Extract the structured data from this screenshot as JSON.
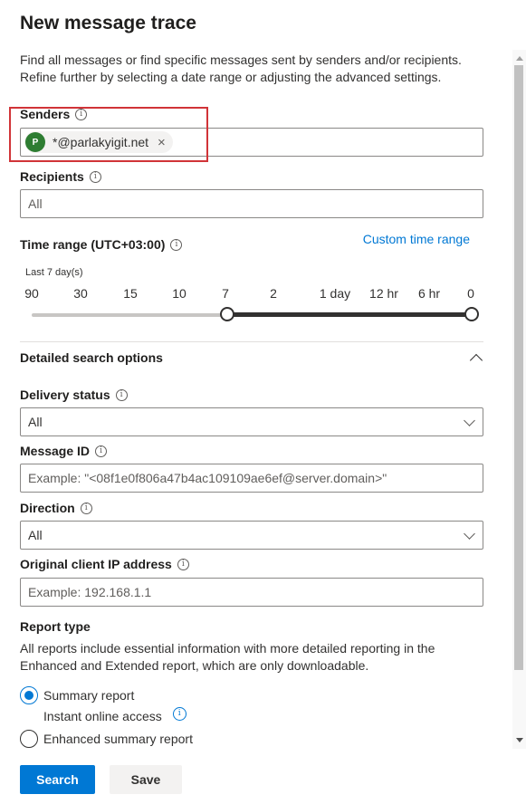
{
  "title": "New message trace",
  "description": "Find all messages or find specific messages sent by senders and/or recipients. Refine further by selecting a date range or adjusting the advanced settings.",
  "senders": {
    "label": "Senders",
    "chip": {
      "avatar": "P",
      "text": "*@parlakyigit.net",
      "remove": "×"
    }
  },
  "recipients": {
    "label": "Recipients",
    "placeholder": "All"
  },
  "time_range": {
    "label": "Time range (UTC+03:00)",
    "custom_link": "Custom time range",
    "slider_caption": "Last 7 day(s)",
    "ticks": [
      "90",
      "30",
      "15",
      "10",
      "7",
      "2",
      "1 day",
      "12 hr",
      "6 hr",
      "0"
    ],
    "selected_start": "7",
    "selected_end": "0"
  },
  "detailed": {
    "title": "Detailed search options",
    "delivery_status": {
      "label": "Delivery status",
      "value": "All"
    },
    "message_id": {
      "label": "Message ID",
      "placeholder": "Example: \"<08f1e0f806a47b4ac109109ae6ef@server.domain>\""
    },
    "direction": {
      "label": "Direction",
      "value": "All"
    },
    "client_ip": {
      "label": "Original client IP address",
      "placeholder": "Example: 192.168.1.1"
    }
  },
  "report_type": {
    "label": "Report type",
    "description": "All reports include essential information with more detailed reporting in the Enhanced and Extended report, which are only downloadable.",
    "options": [
      {
        "label": "Summary report",
        "sublabel": "Instant online access",
        "selected": true
      },
      {
        "label": "Enhanced summary report",
        "selected": false
      }
    ]
  },
  "buttons": {
    "search": "Search",
    "save": "Save"
  },
  "icons": {
    "info": "info-icon",
    "collapse": "chevron-up-icon",
    "dropdown": "chevron-down-icon"
  },
  "colors": {
    "accent": "#0078d4",
    "highlight": "#d13438",
    "avatar": "#2e7d32"
  }
}
